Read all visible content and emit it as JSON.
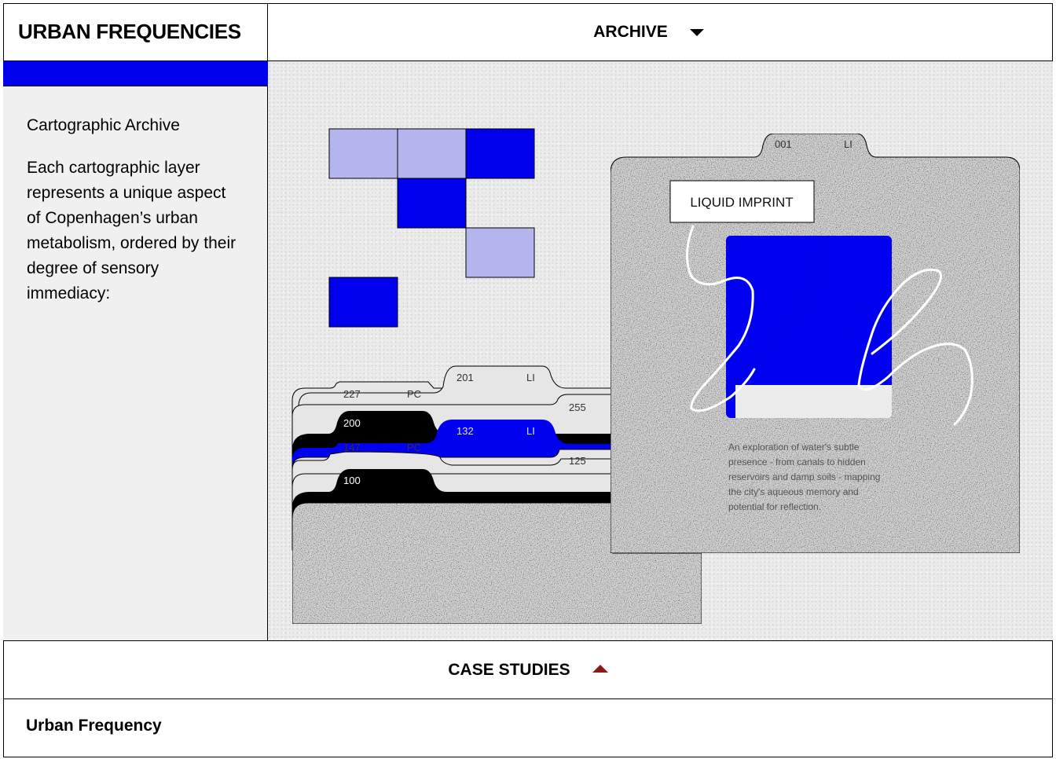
{
  "header": {
    "brand": "URBAN FREQUENCIES",
    "nav_label": "ARCHIVE"
  },
  "sidebar": {
    "title": "Cartographic Archive",
    "body": "Each cartographic layer represents a unique aspect of Copenhagen’s urban metabolism, ordered by their degree of sensory immediacy:"
  },
  "folders": [
    {
      "number": "227",
      "code": "PC"
    },
    {
      "number": "201",
      "code": "LI"
    },
    {
      "number": "255"
    },
    {
      "number": "200"
    },
    {
      "number": "132",
      "code": "LI"
    },
    {
      "number": "147",
      "code": "PC"
    },
    {
      "number": "125"
    },
    {
      "number": "100"
    }
  ],
  "card": {
    "tab_number": "001",
    "tab_code": "LI",
    "title": "LIQUID IMPRINT",
    "description_lines": [
      "An exploration of water's subtle",
      "presence - from canals to hidden",
      "reservoirs and damp soils - mapping",
      "the city's aqueous memory and",
      "potential for reflection."
    ]
  },
  "bottom_nav": {
    "label": "CASE STUDIES"
  },
  "footer": {
    "title": "Urban Frequency"
  },
  "colors": {
    "accent_blue": "#0000ee",
    "light_blue": "#b3b5ec",
    "arrow_red": "#8b1a1a"
  },
  "icons": {
    "archive_toggle": "triangle-down-icon",
    "case_studies_toggle": "triangle-up-icon"
  }
}
